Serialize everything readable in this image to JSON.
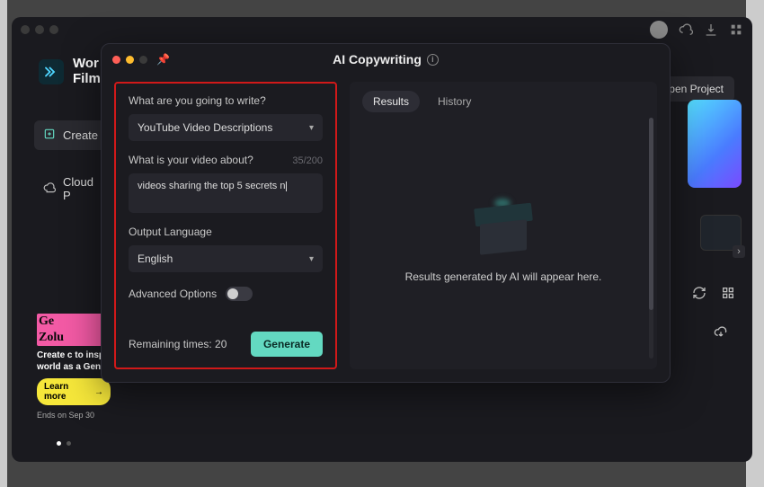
{
  "app": {
    "brand_line1": "Wor",
    "brand_line2": "Film"
  },
  "header": {
    "open_project": "Open Project"
  },
  "sidebar": {
    "create": "Create",
    "cloud": "Cloud P"
  },
  "promo": {
    "logo_l1": "Ge",
    "logo_l2": "Zolu",
    "text": "Create c to inspi world as a Gen Z",
    "learn": "Learn more",
    "ends": "Ends on Sep 30"
  },
  "modal": {
    "title": "AI Copywriting",
    "q_write": "What are you going to write?",
    "type_selected": "YouTube Video Descriptions",
    "q_about": "What is your video about?",
    "about_counter": "35/200",
    "about_value": "videos sharing the top 5 secrets n",
    "out_lang_label": "Output Language",
    "out_lang_value": "English",
    "advanced": "Advanced Options",
    "remaining": "Remaining times: 20",
    "generate": "Generate",
    "tabs": {
      "results": "Results",
      "history": "History"
    },
    "results_empty": "Results generated by AI will appear here."
  }
}
